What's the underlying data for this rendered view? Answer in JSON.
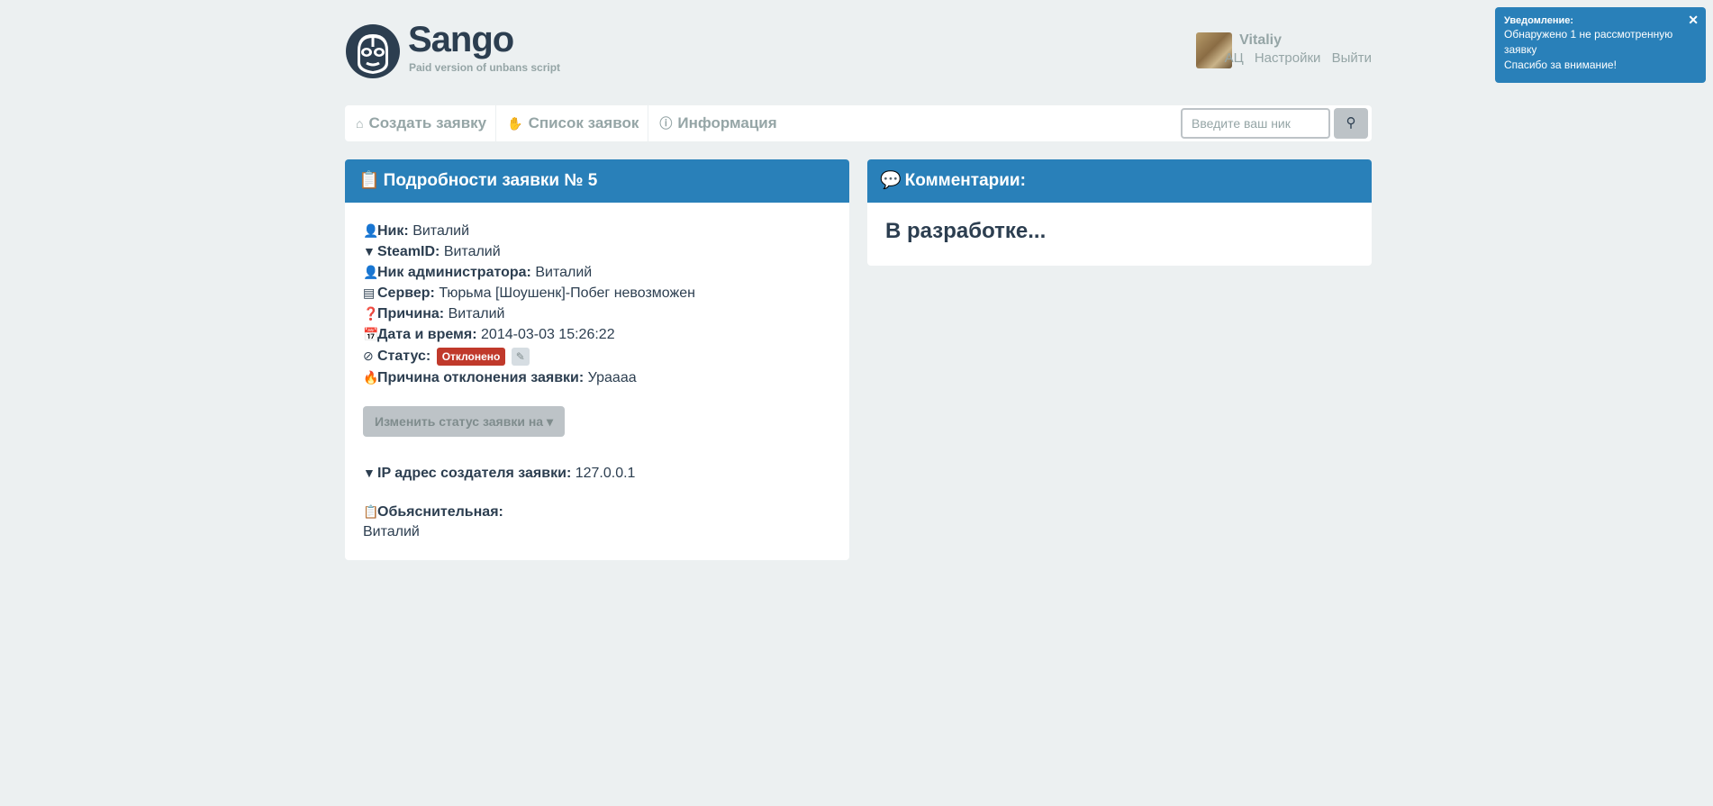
{
  "header": {
    "brand": "Sango",
    "tagline": "Paid version of unbans script"
  },
  "user": {
    "name": "Vitaliy",
    "links": [
      "АЦ",
      "Настройки",
      "Выйти"
    ]
  },
  "nav": {
    "items": [
      {
        "label": "Создать заявку",
        "icon": "home-icon"
      },
      {
        "label": "Список заявок",
        "icon": "hand-icon"
      },
      {
        "label": "Информация",
        "icon": "info-icon"
      }
    ],
    "search_placeholder": "Введите ваш ник",
    "search_icon": "search-icon"
  },
  "details": {
    "title": "Подробности заявки № 5",
    "nick_label": "Ник:",
    "nick": "Виталий",
    "steamid_label": "SteamID:",
    "steamid": "Виталий",
    "admin_label": "Ник администратора:",
    "admin": "Виталий",
    "server_label": "Сервер:",
    "server": "Тюрьма [Шоушенк]-Побег невозможен",
    "reason_label": "Причина:",
    "reason": "Виталий",
    "date_label": "Дата и время:",
    "date": "2014-03-03 15:26:22",
    "status_label": "Статус:",
    "status": "Отклонено",
    "status_color": "#c0392b",
    "reject_label": "Причина отклонения заявки:",
    "reject": "Урaaaa",
    "change_status_button": "Изменить статус заявки на",
    "ip_label": "IP адрес создателя заявки:",
    "ip": "127.0.0.1",
    "explanation_label": "Обьяснительная:",
    "explanation": "Виталий"
  },
  "comments": {
    "title": "Комментарии:",
    "body": "В разработке..."
  },
  "notification": {
    "title": "Уведомление:",
    "line1": "Обнаружено 1 не рассмотренную заявку",
    "line2": "Спасибо за внимание!"
  },
  "colors": {
    "accent": "#2980b9",
    "background": "#ecf0f1",
    "text": "#2c3e50",
    "muted": "#95a5a6"
  }
}
